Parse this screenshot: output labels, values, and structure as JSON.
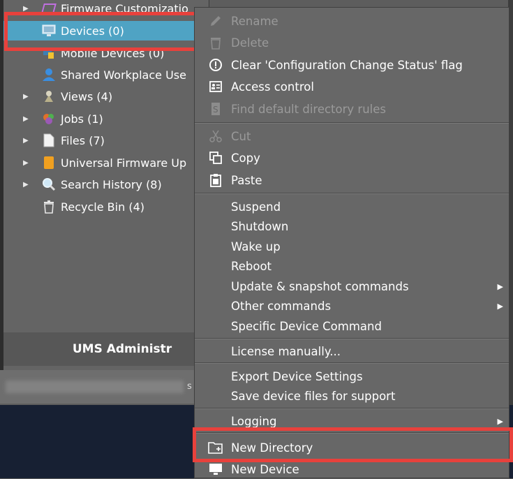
{
  "tree": {
    "items": [
      {
        "label": "Firmware Customizatio",
        "icon": "firmware-icon",
        "arrow": true
      },
      {
        "label": "Devices (0)",
        "icon": "monitor-icon",
        "arrow": false,
        "selected": true
      },
      {
        "label": "Mobile Devices (0)",
        "icon": "mobile-devices-icon",
        "arrow": false
      },
      {
        "label": "Shared Workplace Use",
        "icon": "user-icon",
        "arrow": false
      },
      {
        "label": "Views (4)",
        "icon": "views-icon",
        "arrow": true
      },
      {
        "label": "Jobs (1)",
        "icon": "jobs-icon",
        "arrow": true
      },
      {
        "label": "Files (7)",
        "icon": "file-icon",
        "arrow": true
      },
      {
        "label": "Universal Firmware Up",
        "icon": "universal-firmware-icon",
        "arrow": true
      },
      {
        "label": "Search History (8)",
        "icon": "search-icon",
        "arrow": true
      },
      {
        "label": "Recycle Bin (4)",
        "icon": "trash-icon",
        "arrow": false
      }
    ],
    "admin_label": "UMS Administr",
    "status_letter": "s"
  },
  "menu": {
    "rename": "Rename",
    "delete": "Delete",
    "clear_flag": "Clear 'Configuration Change Status' flag",
    "access_control": "Access control",
    "find_rules": "Find default directory rules",
    "cut": "Cut",
    "copy": "Copy",
    "paste": "Paste",
    "suspend": "Suspend",
    "shutdown": "Shutdown",
    "wake_up": "Wake up",
    "reboot": "Reboot",
    "update_snapshot": "Update & snapshot commands",
    "other_commands": "Other commands",
    "specific_command": "Specific Device Command",
    "license_manually": "License manually...",
    "export_settings": "Export Device Settings",
    "save_files": "Save device files for support",
    "logging": "Logging",
    "new_directory": "New Directory",
    "new_device": "New Device"
  },
  "colors": {
    "selection": "#4fa3c4",
    "highlight": "#e8413c"
  }
}
